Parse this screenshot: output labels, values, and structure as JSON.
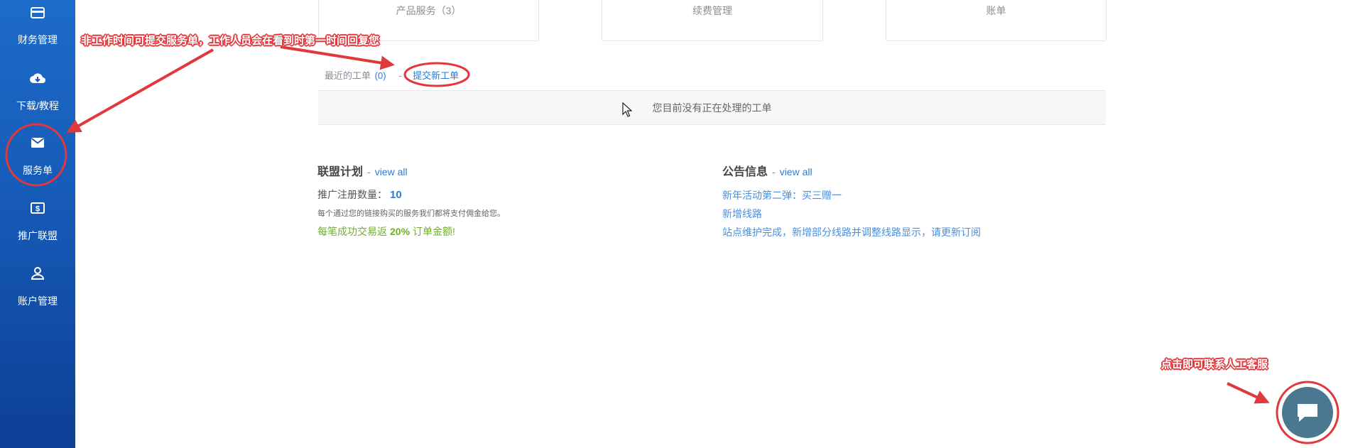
{
  "sidebar": {
    "items": [
      {
        "label": "财务管理",
        "icon": "credit-card-icon"
      },
      {
        "label": "下载/教程",
        "icon": "cloud-download-icon"
      },
      {
        "label": "服务单",
        "icon": "envelope-icon"
      },
      {
        "label": "推广联盟",
        "icon": "dollar-bill-icon"
      },
      {
        "label": "账户管理",
        "icon": "user-icon"
      }
    ]
  },
  "cards": [
    {
      "label": "产品服务（3）"
    },
    {
      "label": "续费管理"
    },
    {
      "label": "账单"
    }
  ],
  "tickets": {
    "label": "最近的工单",
    "count": "(0)",
    "separator": "-",
    "submit_label": "提交新工单",
    "empty_text": "您目前没有正在处理的工单"
  },
  "affiliate": {
    "title": "联盟计划",
    "dash": "-",
    "view_all": "view all",
    "signups_label": "推广注册数量：",
    "signups_count": "10",
    "description": "每个通过您的链接购买的服务我们都将支付佣金给您。",
    "commission_prefix": "每笔成功交易返",
    "commission_percent": "20%",
    "commission_suffix": "订单金额!"
  },
  "announcements": {
    "title": "公告信息",
    "dash": "-",
    "view_all": "view all",
    "items": [
      "新年活动第二弹：买三赠一",
      "新增线路",
      "站点维护完成，新增部分线路并调整线路显示，请更新订阅"
    ]
  },
  "annotations": {
    "ticket_note": "非工作时间可提交服务单，工作人员会在看到时第一时间回复您",
    "chat_note": "点击即可联系人工客服"
  },
  "colors": {
    "sidebar": "#1558b4",
    "link": "#2d7bd5",
    "annotation": "#e0383d",
    "commission": "#6fae2f",
    "chat": "#4a7890"
  }
}
